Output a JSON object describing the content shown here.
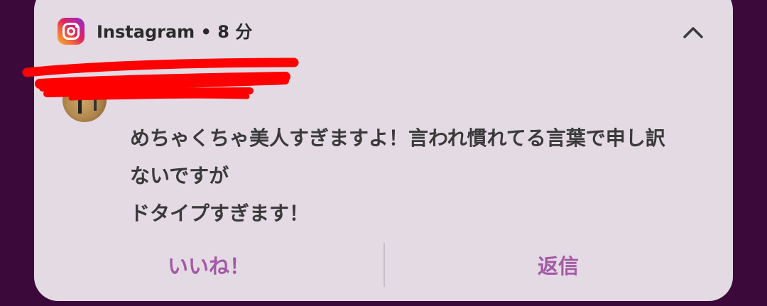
{
  "notification": {
    "app_name": "Instagram",
    "separator": "•",
    "time": "8 分",
    "header_text": "Instagram • 8 分",
    "app_icon": "instagram-icon",
    "collapse_icon": "chevron-up-icon",
    "message_lines": [
      "めちゃくちゃ美人すぎますよ！言われ慣れてる言葉で申し訳",
      "ないですが",
      "ドタイプすぎます！"
    ],
    "actions": {
      "like_label": "いいね！",
      "reply_label": "返信"
    }
  },
  "colors": {
    "background": "#3b0a3a",
    "card": "#e3dae3",
    "action_text": "#a359a5",
    "redaction": "#ff0000"
  }
}
